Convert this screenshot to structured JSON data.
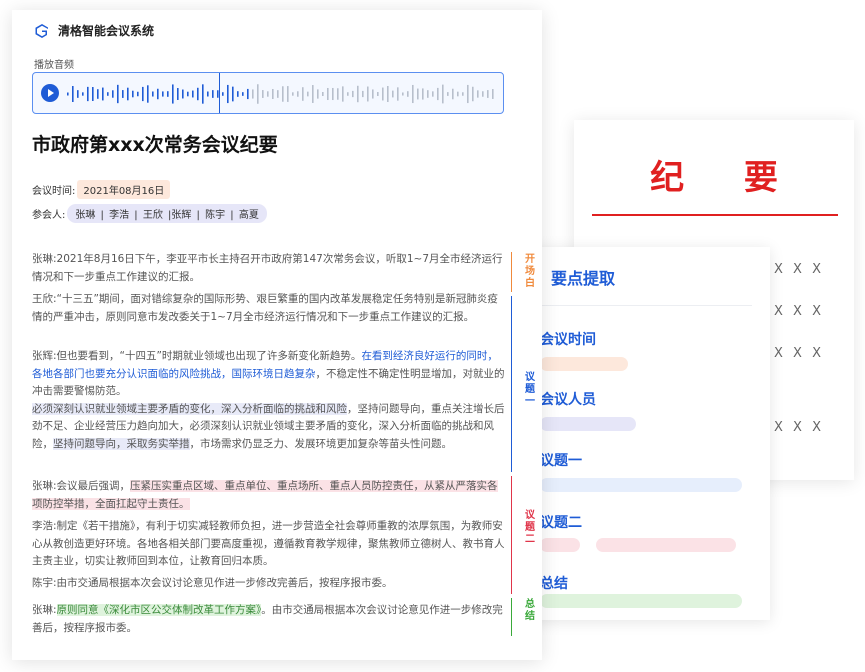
{
  "app": {
    "brand_name": "清格智能会议系统"
  },
  "audio": {
    "label": "播放音频"
  },
  "document": {
    "title": "市政府第xxx次常务会议纪要",
    "time_label": "会议时间:",
    "time_value": "2021年08月16日",
    "attendees_label": "参会人:",
    "attendees_value": "张琳 | 李浩 | 王欣 |张辉 | 陈宇 | 高夏"
  },
  "transcript": [
    {
      "speaker": "张琳:",
      "text": "2021年8月16日下午，李亚平市长主持召开市政府第147次常务会议，听取1~7月全市经济运行情况和下一步重点工作建议的汇报。"
    },
    {
      "speaker": "王欣:",
      "text": "“十三五”期间，面对错综复杂的国际形势、艰巨繁重的国内改革发展稳定任务特别是新冠肺炎疫情的严重冲击，原则同意市发改委关于1~7月全市经济运行情况和下一步重点工作建议的汇报。"
    },
    {
      "speaker": "张辉:",
      "text_a": "但也要看到，“十四五”时期就业领域也出现了许多新变化新趋势。",
      "text_b": "在看到经济良好运行的同时，各地各部门也要充分认识面临的风险挑战，国际环境日趋复杂",
      "text_c": "，不稳定性不确定性明显增加，对就业的冲击需要警惕防范。",
      "text_d": "必须深刻认识就业领域主要矛盾的变化，深入分析面临的挑战和风险",
      "text_e": "，坚持问题导向，重点关注增长后劲不足、企业经营压力趋向加大，必须深刻认识就业领域主要矛盾的变化，深入分析面临的挑战和风险，",
      "text_f": "坚持问题导向，采取务实举措",
      "text_g": "，市场需求仍显乏力、发展环境更加复杂等苗头性问题。"
    },
    {
      "speaker": "张琳:",
      "text_a": "会议最后强调，",
      "text_b": "压紧压实重点区域、重点单位、重点场所、重点人员防控责任，从紧从严落实各项防控举措，全面扛起守土责任。"
    },
    {
      "speaker": "李浩:",
      "text": "制定《若干措施》，有利于切实减轻教师负担，进一步营造全社会尊师重教的浓厚氛围，为教师安心从教创造更好环境。各地各相关部门要高度重视，遵循教育教学规律，聚焦教师立德树人、教书育人主责主业，切实让教师回到本位，让教育回归本质。"
    },
    {
      "speaker": "陈宇:",
      "text": "由市交通局根据本次会议讨论意见作进一步修改完善后，按程序报市委。"
    },
    {
      "speaker": "张琳:",
      "text_a": "原则同意《深化市区公交体制改革工作方案》",
      "text_b": "。由市交通局根据本次会议讨论意见作进一步修改完善后，按程序报市委。"
    }
  ],
  "brackets": [
    {
      "label": "开场白",
      "color": "#f08a3c"
    },
    {
      "label": "议题一",
      "color": "#1f5cd6"
    },
    {
      "label": "议题二",
      "color": "#e0354a"
    },
    {
      "label": "总结",
      "color": "#3aa93a"
    }
  ],
  "points": {
    "title": "要点提取",
    "items": [
      "会议时间",
      "会议人员",
      "议题一",
      "议题二",
      "总结"
    ]
  },
  "summary_doc": {
    "title": "纪 要",
    "xx": "X X X"
  },
  "colors": {
    "accent": "#1f5cd6",
    "red": "#e02020"
  }
}
